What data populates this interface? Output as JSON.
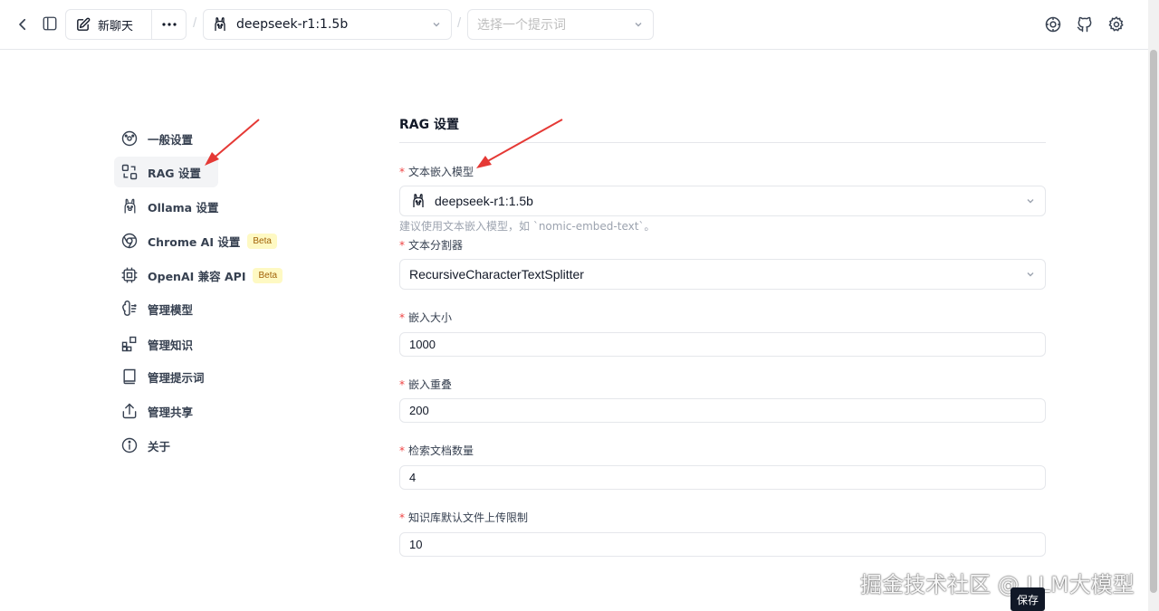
{
  "topbar": {
    "new_chat": "新聊天",
    "model": "deepseek-r1:1.5b",
    "prompt_placeholder": "选择一个提示词"
  },
  "sidebar": {
    "items": [
      {
        "label": "一般设置",
        "icon": "palette-icon"
      },
      {
        "label": "RAG 设置",
        "icon": "rag-icon"
      },
      {
        "label": "Ollama 设置",
        "icon": "ollama-icon"
      },
      {
        "label": "Chrome AI 设置",
        "icon": "chrome-icon",
        "badge": "Beta"
      },
      {
        "label": "OpenAI 兼容 API",
        "icon": "chip-icon",
        "badge": "Beta"
      },
      {
        "label": "管理模型",
        "icon": "brain-icon"
      },
      {
        "label": "管理知识",
        "icon": "blocks-icon"
      },
      {
        "label": "管理提示词",
        "icon": "book-icon"
      },
      {
        "label": "管理共享",
        "icon": "share-icon"
      },
      {
        "label": "关于",
        "icon": "info-icon"
      }
    ]
  },
  "main": {
    "title": "RAG 设置",
    "embedding_model": {
      "label": "文本嵌入模型",
      "value": "deepseek-r1:1.5b",
      "help": "建议使用文本嵌入模型，如 `nomic-embed-text`。"
    },
    "splitter": {
      "label": "文本分割器",
      "value": "RecursiveCharacterTextSplitter"
    },
    "chunk_size": {
      "label": "嵌入大小",
      "value": "1000"
    },
    "chunk_overlap": {
      "label": "嵌入重叠",
      "value": "200"
    },
    "retrieval_count": {
      "label": "检索文档数量",
      "value": "4"
    },
    "upload_limit": {
      "label": "知识库默认文件上传限制",
      "value": "10"
    },
    "save": "保存"
  },
  "watermark": "掘金技术社区 @ LLM大模型",
  "colors": {
    "accent": "#111827",
    "required": "#ef4444",
    "beta_bg": "#fef9c3",
    "annotation_arrow": "#e53935"
  }
}
